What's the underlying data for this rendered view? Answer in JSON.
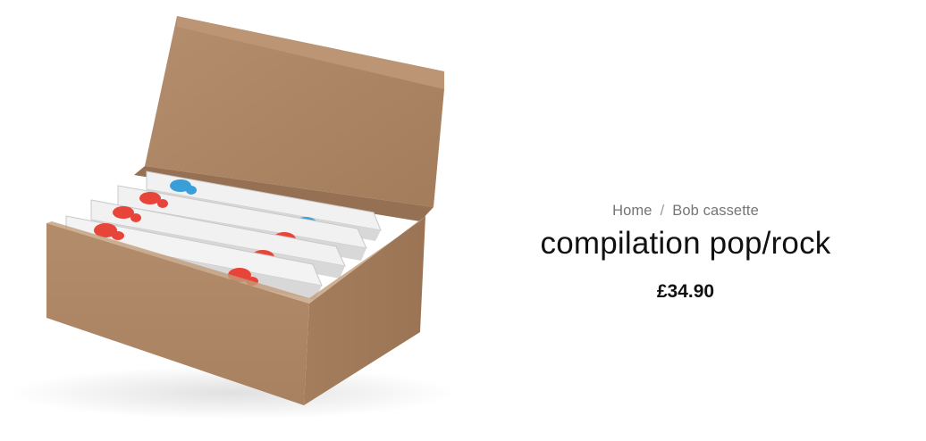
{
  "breadcrumb": {
    "home_label": "Home",
    "separator": "/",
    "category_label": "Bob cassette"
  },
  "product": {
    "title": "compilation pop/rock",
    "price": "£34.90",
    "image_alt": "Cardboard box holding four cassette cases"
  },
  "colors": {
    "box_cardboard": "#b08a68",
    "cassette_case": "#f1f1f1",
    "cassette_red": "#e8453a",
    "cassette_blue": "#3a9fd8",
    "text_primary": "#111111",
    "text_muted": "#757575"
  }
}
